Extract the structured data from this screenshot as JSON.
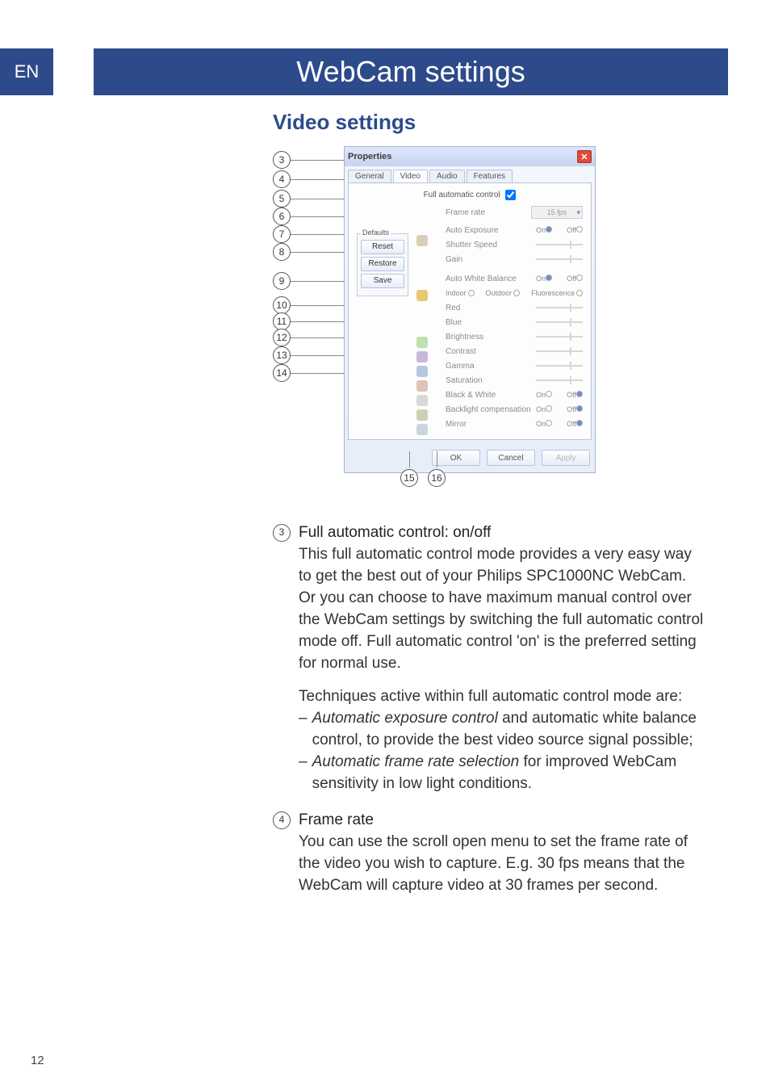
{
  "lang_badge": "EN",
  "title": "WebCam settings",
  "subtitle": "Video settings",
  "page_number": "12",
  "dialog": {
    "title": "Properties",
    "tabs": {
      "general": "General",
      "video": "Video",
      "audio": "Audio",
      "features": "Features"
    },
    "full_auto_label": "Full automatic control",
    "defaults": {
      "legend": "Defaults",
      "reset": "Reset",
      "restore": "Restore",
      "save": "Save"
    },
    "rows": {
      "frame_rate": "Frame rate",
      "frame_rate_value": "15 fps",
      "auto_exposure": "Auto Exposure",
      "shutter_speed": "Shutter Speed",
      "gain": "Gain",
      "auto_wb": "Auto White Balance",
      "indoor": "Indoor",
      "outdoor": "Outdoor",
      "fluorescence": "Fluorescence",
      "red": "Red",
      "blue": "Blue",
      "brightness": "Brightness",
      "contrast": "Contrast",
      "gamma": "Gamma",
      "saturation": "Saturation",
      "black_white": "Black & White",
      "backlight": "Backlight compensation",
      "mirror": "Mirror",
      "on": "On",
      "off": "Off"
    },
    "buttons": {
      "ok": "OK",
      "cancel": "Cancel",
      "apply": "Apply"
    }
  },
  "callouts": {
    "n3": "3",
    "n4": "4",
    "n5": "5",
    "n6": "6",
    "n7": "7",
    "n8": "8",
    "n9": "9",
    "n10": "10",
    "n11": "11",
    "n12": "12",
    "n13": "13",
    "n14": "14",
    "n15": "15",
    "n16": "16"
  },
  "section3": {
    "num": "3",
    "title": "Full automatic control: on/off",
    "p1": "This full automatic control mode provides a very easy way to get the best out of your Philips SPC1000NC WebCam.",
    "p2": "Or you can choose to have maximum manual control over the WebCam settings by switching the full automatic control mode off. Full automatic control 'on' is the preferred setting for normal use.",
    "p3": "Techniques active within full automatic control mode are:",
    "b1a": "Automatic exposure control",
    "b1b": " and automatic white balance control, to provide the best video source signal possible;",
    "b2a": "Automatic frame rate selection",
    "b2b": " for improved WebCam sensitivity in low light conditions."
  },
  "section4": {
    "num": "4",
    "title": "Frame rate",
    "p1": "You can use the scroll open menu to set the frame rate of the video you wish to capture. E.g. 30 fps means that the WebCam will capture video at 30 frames per second."
  }
}
